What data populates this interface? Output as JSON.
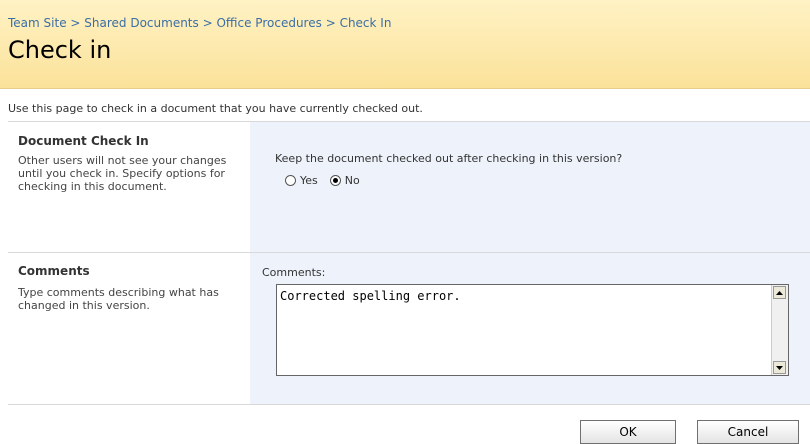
{
  "breadcrumb": {
    "items": [
      "Team Site",
      "Shared Documents",
      "Office Procedures",
      "Check In"
    ],
    "separator": ">"
  },
  "page": {
    "title": "Check in",
    "description": "Use this page to check in a document that you have currently checked out."
  },
  "sections": {
    "checkin": {
      "title": "Document Check In",
      "text": "Other users will not see your changes until you check in. Specify options for checking in this document.",
      "question": "Keep the document checked out after checking in this version?",
      "options": [
        {
          "label": "Yes",
          "selected": false
        },
        {
          "label": "No",
          "selected": true
        }
      ]
    },
    "comments": {
      "title": "Comments",
      "text": "Type comments describing what has changed in this version.",
      "field_label": "Comments:",
      "value": "Corrected spelling error."
    }
  },
  "buttons": {
    "ok": "OK",
    "cancel": "Cancel"
  },
  "colors": {
    "header_bg": "#fbe29a",
    "breadcrumb_link": "#3b6ea5",
    "panel_bg": "#eef3fb"
  }
}
